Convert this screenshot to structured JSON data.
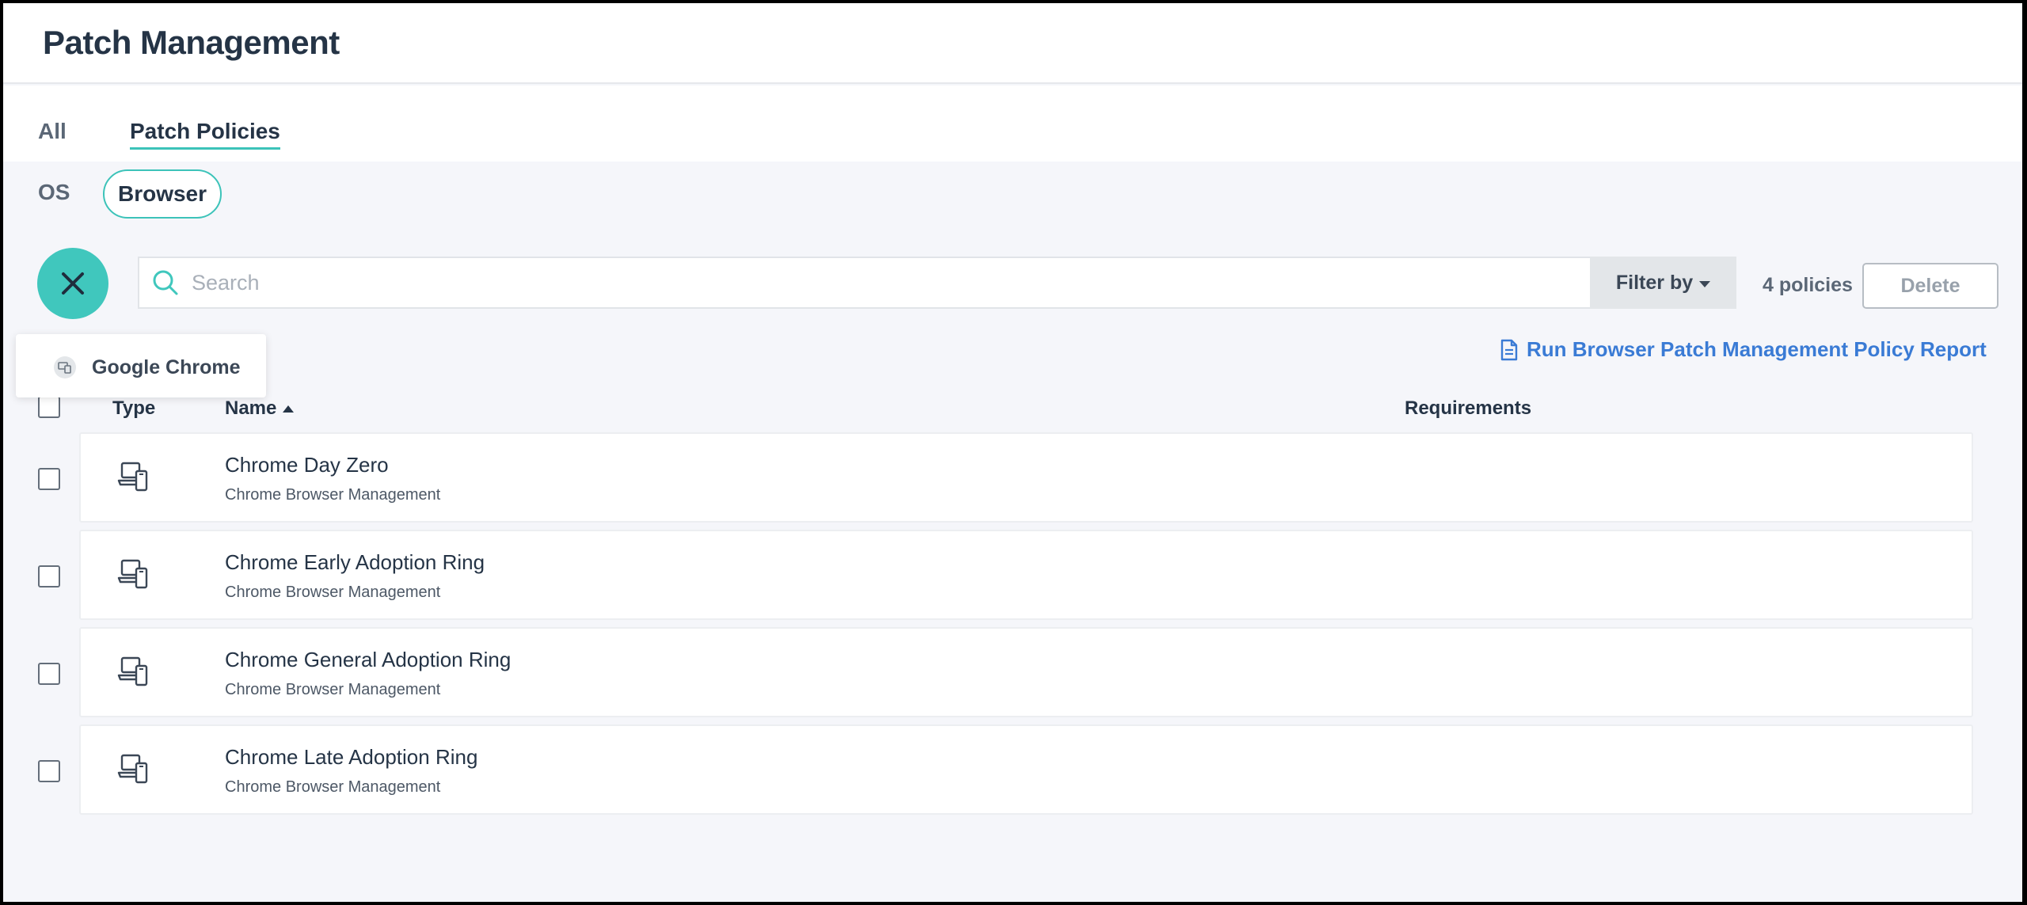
{
  "page": {
    "title": "Patch Management"
  },
  "tabs": [
    {
      "label": "All",
      "active": false
    },
    {
      "label": "Patch Policies",
      "active": true
    }
  ],
  "subtabs": [
    {
      "label": "OS",
      "active": false
    },
    {
      "label": "Browser",
      "active": true
    }
  ],
  "fab": {
    "icon": "close-icon"
  },
  "search": {
    "placeholder": "Search",
    "value": ""
  },
  "filter": {
    "label": "Filter by"
  },
  "policy_count": "4 policies",
  "delete_label": "Delete",
  "dropdown": {
    "item_label": "Google Chrome",
    "item_icon": "chrome-browser-icon"
  },
  "report_link": {
    "label": "Run Browser Patch Management Policy Report",
    "icon": "document-icon"
  },
  "table": {
    "columns": {
      "type": "Type",
      "name": "Name",
      "requirements": "Requirements"
    },
    "sort": {
      "column": "Name",
      "direction": "ascending"
    },
    "rows": [
      {
        "title": "Chrome Day Zero",
        "subtitle": "Chrome Browser Management",
        "type_icon": "device-policy-icon"
      },
      {
        "title": "Chrome Early Adoption Ring",
        "subtitle": "Chrome Browser Management",
        "type_icon": "device-policy-icon"
      },
      {
        "title": "Chrome General Adoption Ring",
        "subtitle": "Chrome Browser Management",
        "type_icon": "device-policy-icon"
      },
      {
        "title": "Chrome Late Adoption Ring",
        "subtitle": "Chrome Browser Management",
        "type_icon": "device-policy-icon"
      }
    ]
  },
  "colors": {
    "accent": "#40c7bd",
    "link": "#3a7bd5",
    "text": "#253446"
  }
}
